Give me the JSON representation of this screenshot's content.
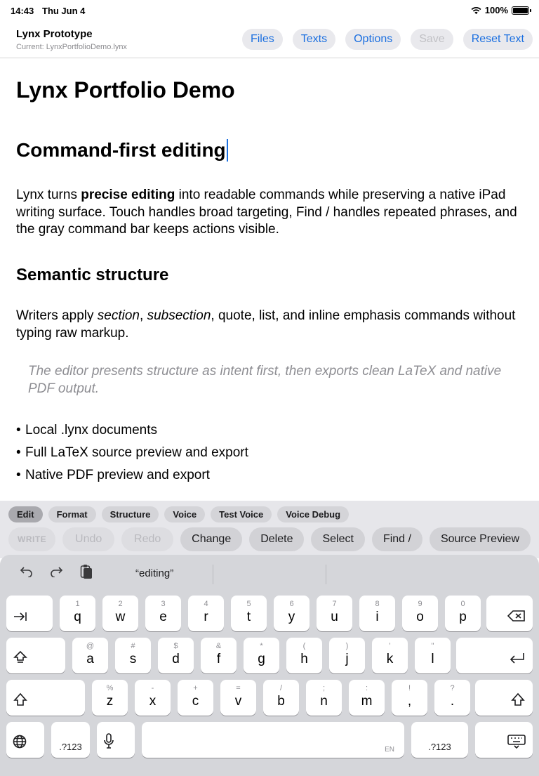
{
  "status": {
    "time": "14:43",
    "date": "Thu Jun 4",
    "battery": "100%",
    "battery_level": 1.0
  },
  "nav": {
    "title": "Lynx Prototype",
    "subtitle": "Current: LynxPortfolioDemo.lynx",
    "buttons": {
      "files": "Files",
      "texts": "Texts",
      "options": "Options",
      "save": "Save",
      "reset": "Reset Text"
    }
  },
  "document": {
    "title": "Lynx Portfolio Demo",
    "section": "Command-first editing",
    "para1": {
      "a": "Lynx turns ",
      "bold": "precise editing",
      "b": " into readable commands while preserving a native iPad writing surface. Touch handles broad targeting, Find / handles repeated phrases, and the gray command bar keeps actions visible."
    },
    "subsection": "Semantic structure",
    "para2": {
      "a": "Writers apply ",
      "em1": "section",
      "b": ", ",
      "em2": "subsection",
      "c": ", quote, list, and inline emphasis commands without typing raw markup."
    },
    "quote": "The editor presents structure as intent first, then exports clean LaTeX and native PDF output.",
    "bullet": "•",
    "list": [
      "Local .lynx documents",
      "Full LaTeX source preview and export",
      "Native PDF preview and export"
    ]
  },
  "command_bar": {
    "tabs": [
      "Edit",
      "Format",
      "Structure",
      "Voice",
      "Test Voice",
      "Voice Debug"
    ],
    "actions": {
      "write": "WRITE",
      "undo": "Undo",
      "redo": "Redo",
      "change": "Change",
      "delete": "Delete",
      "select": "Select",
      "find": "Find /",
      "source": "Source Preview"
    }
  },
  "keyboard": {
    "suggestion": "“editing”",
    "row1": [
      {
        "k": "q",
        "h": "1"
      },
      {
        "k": "w",
        "h": "2"
      },
      {
        "k": "e",
        "h": "3"
      },
      {
        "k": "r",
        "h": "4"
      },
      {
        "k": "t",
        "h": "5"
      },
      {
        "k": "y",
        "h": "6"
      },
      {
        "k": "u",
        "h": "7"
      },
      {
        "k": "i",
        "h": "8"
      },
      {
        "k": "o",
        "h": "9"
      },
      {
        "k": "p",
        "h": "0"
      }
    ],
    "row2": [
      {
        "k": "a",
        "h": "@"
      },
      {
        "k": "s",
        "h": "#"
      },
      {
        "k": "d",
        "h": "$"
      },
      {
        "k": "f",
        "h": "&"
      },
      {
        "k": "g",
        "h": "*"
      },
      {
        "k": "h",
        "h": "("
      },
      {
        "k": "j",
        "h": ")"
      },
      {
        "k": "k",
        "h": "’"
      },
      {
        "k": "l",
        "h": "\""
      }
    ],
    "row3": [
      {
        "k": "z",
        "h": "%"
      },
      {
        "k": "x",
        "h": "-"
      },
      {
        "k": "c",
        "h": "+"
      },
      {
        "k": "v",
        "h": "="
      },
      {
        "k": "b",
        "h": "/"
      },
      {
        "k": "n",
        "h": ";"
      },
      {
        "k": "m",
        "h": ":"
      },
      {
        "k": ",",
        "h": "!"
      },
      {
        "k": ".",
        "h": "?"
      }
    ],
    "numbers_label": ".?123",
    "lang": "EN"
  }
}
